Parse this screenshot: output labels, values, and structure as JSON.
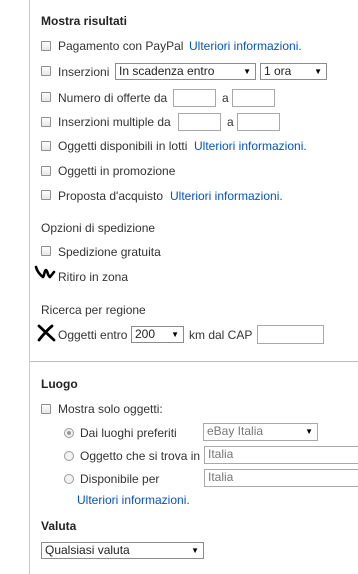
{
  "results": {
    "heading": "Mostra risultati",
    "paypal": {
      "label": "Pagamento con PayPal",
      "link": "Ulteriori informazioni."
    },
    "listings": {
      "label": "Inserzioni",
      "select": "In scadenza entro",
      "time": "1 ora"
    },
    "bids": {
      "label": "Numero di offerte da",
      "to": "a"
    },
    "multiple": {
      "label": "Inserzioni multiple da",
      "to": "a"
    },
    "lots": {
      "label": "Oggetti disponibili in lotti",
      "link": "Ulteriori informazioni."
    },
    "promo": {
      "label": "Oggetti in promozione"
    },
    "best_offer": {
      "label": "Proposta d'acquisto",
      "link": "Ulteriori informazioni."
    }
  },
  "shipping": {
    "heading": "Opzioni di spedizione",
    "free": "Spedizione gratuita",
    "pickup": "Ritiro in zona"
  },
  "region": {
    "heading": "Ricerca per regione",
    "within_label": "Oggetti entro",
    "distance": "200",
    "suffix": "km dal CAP"
  },
  "location": {
    "heading": "Luogo",
    "show_only": "Mostra solo oggetti:",
    "preferred": {
      "label": "Dai luoghi preferiti",
      "value": "eBay Italia"
    },
    "located_in": {
      "label": "Oggetto che si trova in",
      "value": "Italia"
    },
    "available": {
      "label": "Disponibile per",
      "value": "Italia"
    },
    "link": "Ulteriori informazioni."
  },
  "currency": {
    "heading": "Valuta",
    "value": "Qualsiasi valuta"
  }
}
